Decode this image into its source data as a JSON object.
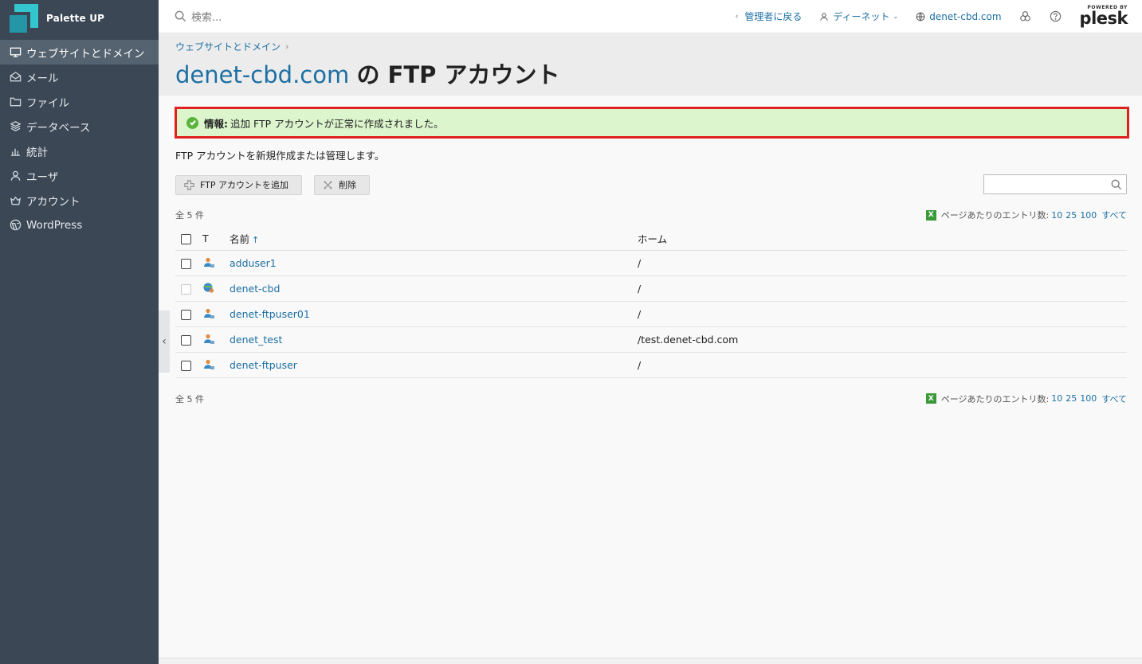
{
  "brand": {
    "name": "Palette UP"
  },
  "sidebar": {
    "items": [
      {
        "label": "ウェブサイトとドメイン",
        "icon": "monitor-icon",
        "active": true
      },
      {
        "label": "メール",
        "icon": "mail-icon"
      },
      {
        "label": "ファイル",
        "icon": "folder-icon"
      },
      {
        "label": "データベース",
        "icon": "database-icon"
      },
      {
        "label": "統計",
        "icon": "chart-icon"
      },
      {
        "label": "ユーザ",
        "icon": "user-icon"
      },
      {
        "label": "アカウント",
        "icon": "account-icon"
      },
      {
        "label": "WordPress",
        "icon": "wordpress-icon"
      }
    ]
  },
  "topbar": {
    "search_placeholder": "検索...",
    "back_label": "管理者に戻る",
    "user_label": "ディーネット",
    "domain_label": "denet-cbd.com",
    "powered_by": "POWERED BY",
    "plesk": "plesk"
  },
  "header": {
    "breadcrumb": "ウェブサイトとドメイン",
    "title_domain": "denet-cbd.com",
    "title_rest": "の FTP アカウント"
  },
  "message": {
    "label": "情報:",
    "text": "追加 FTP アカウントが正常に作成されました。"
  },
  "description": "FTP アカウントを新規作成または管理します。",
  "toolbar": {
    "add_label": "FTP アカウントを追加",
    "delete_label": "削除"
  },
  "list": {
    "total": "全 5 件",
    "per_page_label": "ページあたりのエントリ数:",
    "per_page_options": [
      "10",
      "25",
      "100",
      "すべて"
    ],
    "columns": {
      "type": "T",
      "name": "名前",
      "sort_arrow": "↑",
      "home": "ホーム"
    },
    "rows": [
      {
        "name": "adduser1",
        "home": "/",
        "kind": "user",
        "disabled": false
      },
      {
        "name": "denet-cbd",
        "home": "/",
        "kind": "system",
        "disabled": true
      },
      {
        "name": "denet-ftpuser01",
        "home": "/",
        "kind": "user",
        "disabled": false
      },
      {
        "name": "denet_test",
        "home": "/test.denet-cbd.com",
        "kind": "user",
        "disabled": false
      },
      {
        "name": "denet-ftpuser",
        "home": "/",
        "kind": "user",
        "disabled": false
      }
    ]
  },
  "colors": {
    "accent": "#1c6fa3",
    "sidebar": "#3b4755",
    "success_bg": "#dcf5cd",
    "highlight_border": "#e0201f"
  }
}
